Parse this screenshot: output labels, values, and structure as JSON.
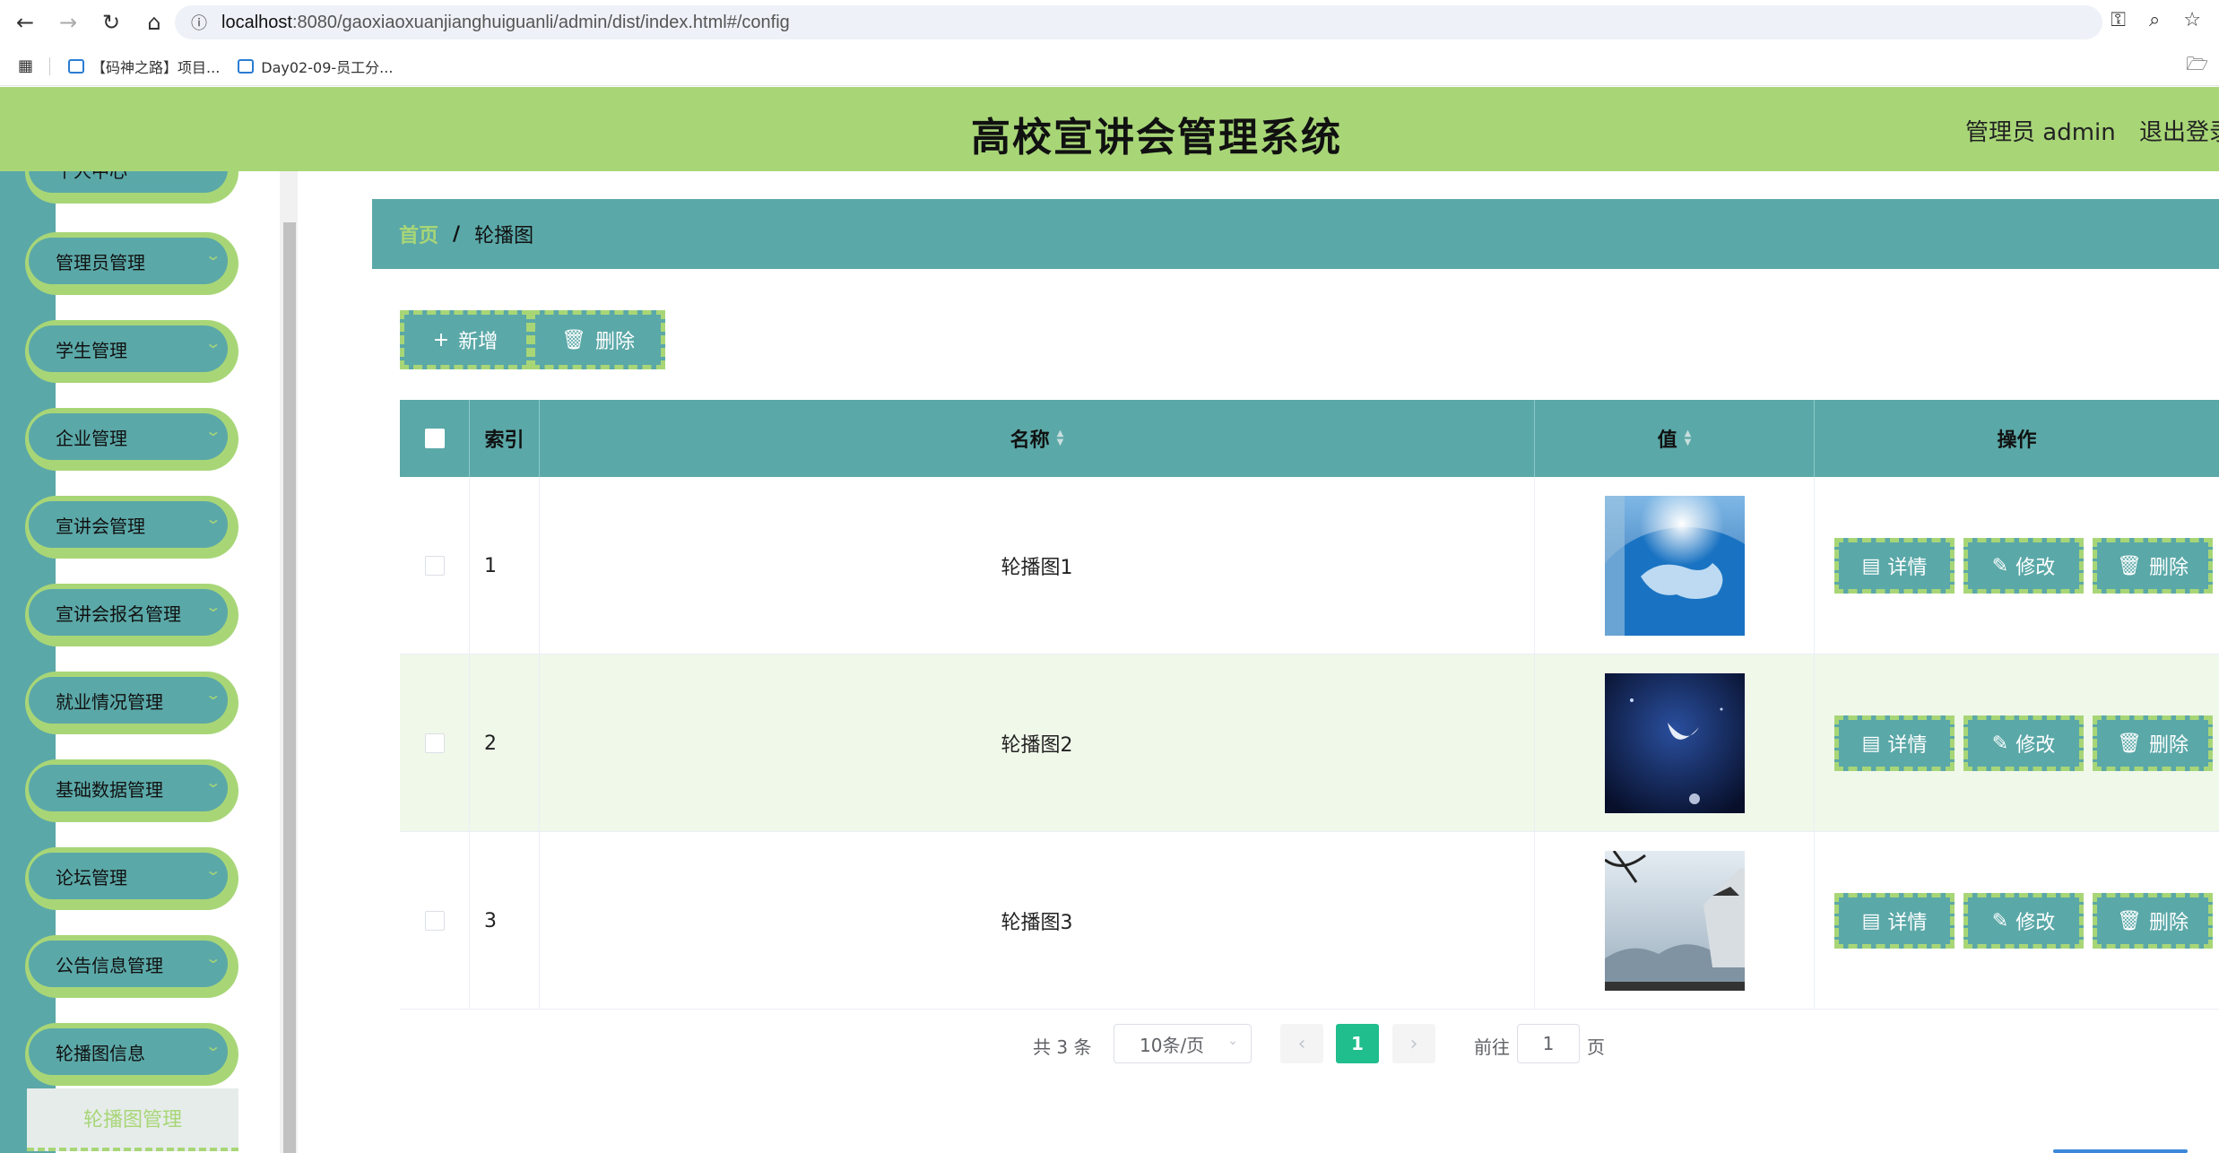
{
  "browser": {
    "url_host": "localhost",
    "url_rest": ":8080/gaoxiaoxuanjianghuiguanli/admin/dist/index.html#/config",
    "bookmarks": [
      "【码神之路】项目...",
      "Day02-09-员工分..."
    ]
  },
  "header": {
    "title": "高校宣讲会管理系统",
    "admin": "管理员 admin",
    "logout": "退出登录"
  },
  "sidebar": {
    "items": [
      {
        "label": "个人中心"
      },
      {
        "label": "管理员管理"
      },
      {
        "label": "学生管理"
      },
      {
        "label": "企业管理"
      },
      {
        "label": "宣讲会管理"
      },
      {
        "label": "宣讲会报名管理"
      },
      {
        "label": "就业情况管理"
      },
      {
        "label": "基础数据管理"
      },
      {
        "label": "论坛管理"
      },
      {
        "label": "公告信息管理"
      },
      {
        "label": "轮播图信息"
      }
    ],
    "active_sub": "轮播图管理"
  },
  "breadcrumb": {
    "home": "首页",
    "sep": "/",
    "current": "轮播图"
  },
  "toolbar": {
    "add_label": "新增",
    "delete_label": "删除"
  },
  "table": {
    "headers": {
      "index": "索引",
      "name": "名称",
      "value": "值",
      "ops": "操作"
    },
    "rows": [
      {
        "index": "1",
        "name": "轮播图1"
      },
      {
        "index": "2",
        "name": "轮播图2"
      },
      {
        "index": "3",
        "name": "轮播图3"
      }
    ],
    "ops": {
      "detail": "详情",
      "edit": "修改",
      "delete": "删除"
    }
  },
  "pagination": {
    "total": "共 3 条",
    "page_size": "10条/页",
    "current_page": "1",
    "goto_label": "前往",
    "goto_value": "1",
    "page_unit": "页"
  },
  "colors": {
    "header": "#a8d677",
    "teal": "#5ba8a8",
    "active_page": "#1fbe8c"
  }
}
